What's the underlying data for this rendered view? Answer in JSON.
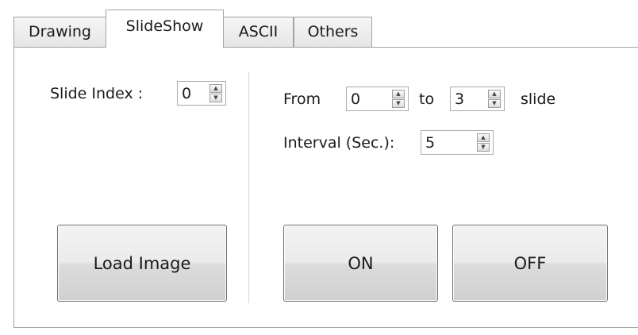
{
  "tabs": [
    {
      "label": "Drawing",
      "active": false
    },
    {
      "label": "SlideShow",
      "active": true
    },
    {
      "label": "ASCII",
      "active": false
    },
    {
      "label": "Others",
      "active": false
    }
  ],
  "left_panel": {
    "slide_index_label": "Slide Index :",
    "slide_index_value": "0",
    "load_image_label": "Load Image"
  },
  "right_panel": {
    "from_label": "From",
    "from_value": "0",
    "to_label": "to",
    "to_value": "3",
    "slide_label": "slide",
    "interval_label": "Interval (Sec.):",
    "interval_value": "5",
    "on_label": "ON",
    "off_label": "OFF"
  },
  "spinner_icons": {
    "up": "▲",
    "down": "▼"
  }
}
